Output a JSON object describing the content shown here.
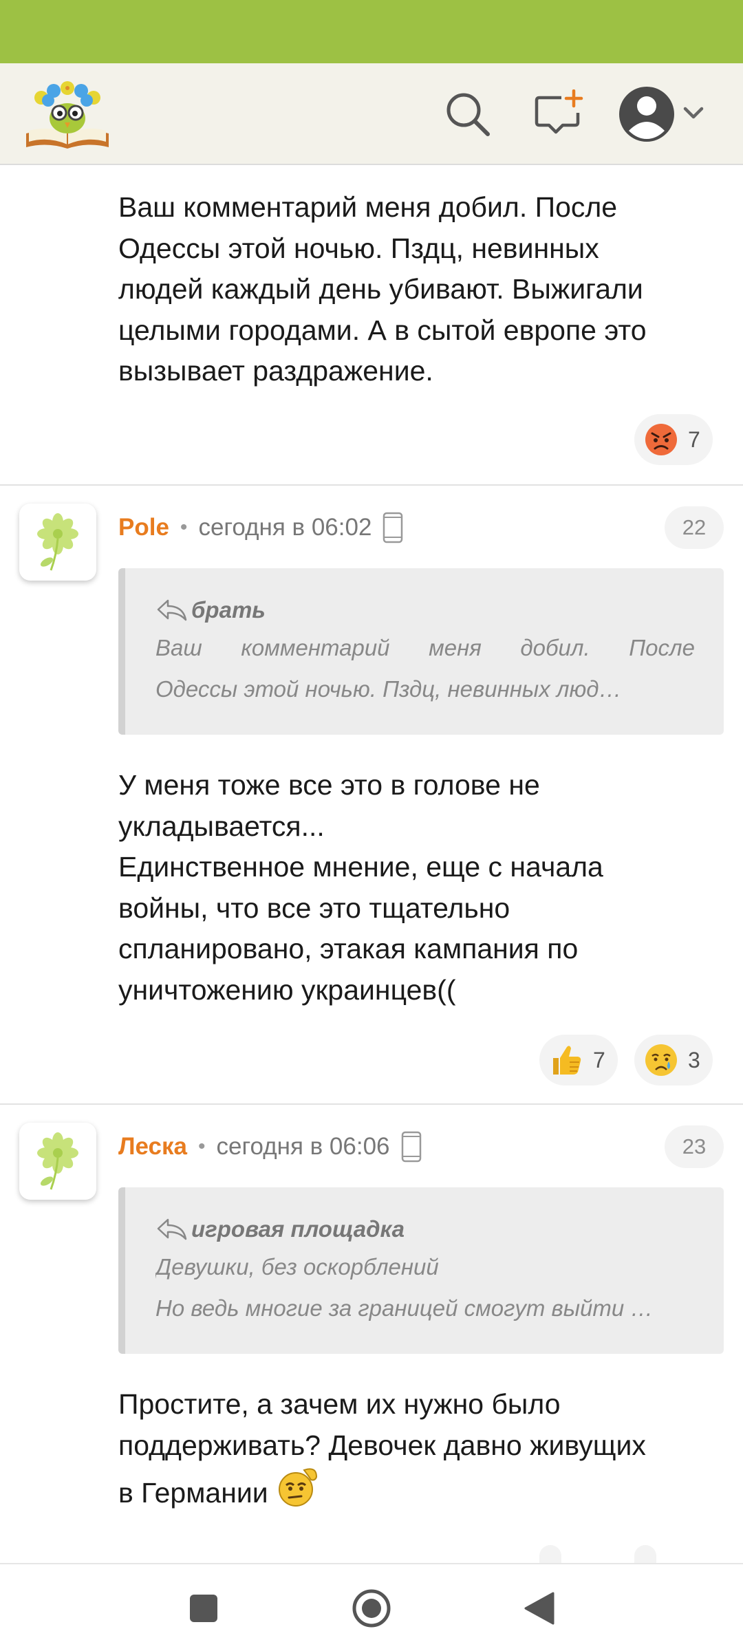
{
  "header": {
    "logo_icon": "reading-owl-logo-icon",
    "search_icon": "search-icon",
    "compose_icon": "new-message-icon",
    "profile_icon": "user-avatar-icon",
    "dropdown_icon": "chevron-down-icon"
  },
  "comments": [
    {
      "text_lines": [
        "Ваш комментарий меня добил. После",
        "Одессы этой ночью. Пздц, невинных",
        "людей каждый день убивают. Выжигали",
        "целыми городами. А в сытой европе это",
        "вызывает раздражение."
      ],
      "reactions": [
        {
          "icon": "angry-face-icon",
          "count": "7"
        }
      ]
    },
    {
      "author": "Pole",
      "separator": "•",
      "time": "сегодня в 06:02",
      "device_icon": "mobile-phone-icon",
      "number": "22",
      "quote": {
        "author": "брать",
        "line1_words": [
          "Ваш",
          "комментарий",
          "меня",
          "добил.",
          "После"
        ],
        "line2": "Одессы этой ночью. Пздц, невинных люд…"
      },
      "text_lines": [
        "У меня тоже все это в голове не",
        "укладывается...",
        "Единственное мнение, еще с начала",
        "войны, что все это тщательно",
        "спланировано, этакая кампания по",
        "уничтожению украинцев(("
      ],
      "reactions": [
        {
          "icon": "thumbs-up-icon",
          "count": "7"
        },
        {
          "icon": "crying-face-icon",
          "count": "3"
        }
      ]
    },
    {
      "author": "Леска",
      "separator": "•",
      "time": "сегодня в 06:06",
      "device_icon": "mobile-phone-icon",
      "number": "23",
      "quote": {
        "author": "игровая площадка",
        "line1": "Девушки, без оскорблений",
        "line2": "Но ведь многие за границей смогут выйти …"
      },
      "text_lines": [
        "Простите, а зачем их нужно было",
        "поддерживать? Девочек давно живущих",
        "в Германии"
      ],
      "inline_emoji": "thinking-smiley-icon"
    }
  ],
  "nav": {
    "recent_icon": "square-recents-icon",
    "home_icon": "circle-home-icon",
    "back_icon": "triangle-back-icon"
  }
}
